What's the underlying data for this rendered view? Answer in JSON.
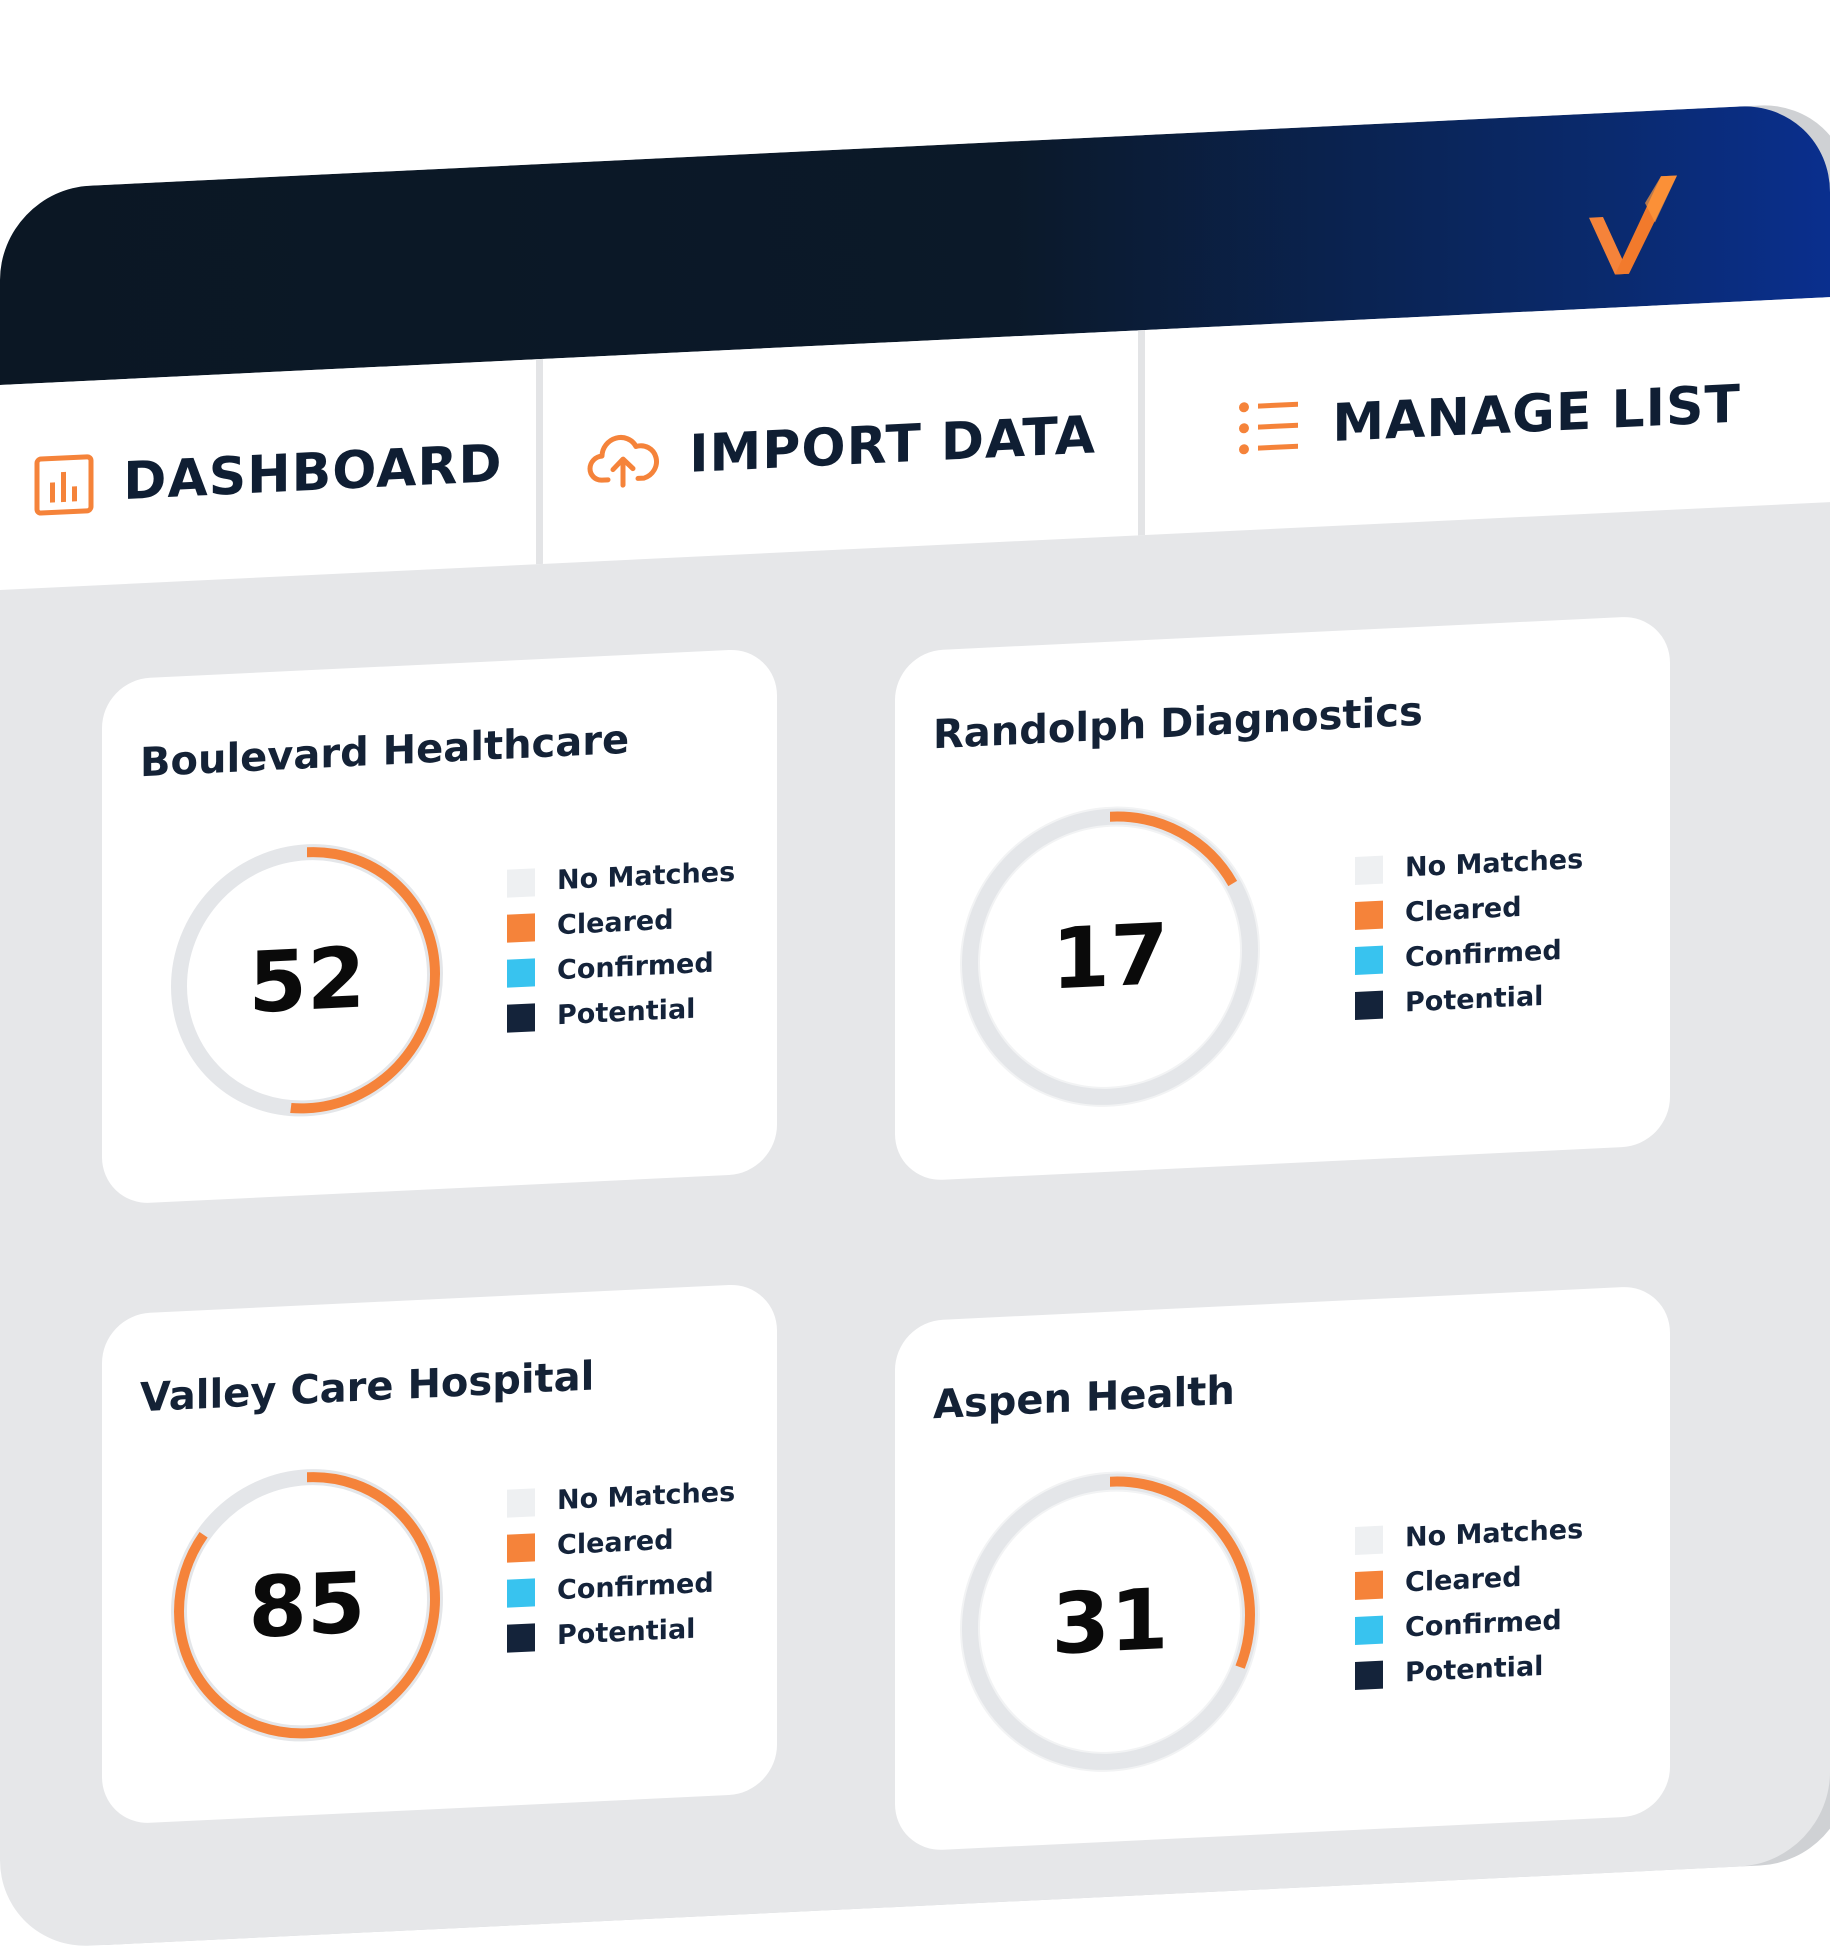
{
  "app": {
    "logo": "checkmark-logo",
    "colors": {
      "accent": "#f5833a",
      "titlebar": "#0b1724",
      "titlebar_end": "#0a2f8e",
      "frame": "#e6e7e9",
      "track": "#e4e6e9"
    }
  },
  "tabs": [
    {
      "label": "DASHBOARD",
      "icon": "bar-chart-icon"
    },
    {
      "label": "IMPORT DATA",
      "icon": "cloud-upload-icon"
    },
    {
      "label": "MANAGE LIST",
      "icon": "list-icon"
    }
  ],
  "legend": [
    {
      "label": "No Matches",
      "color": "#eef0f2"
    },
    {
      "label": "Cleared",
      "color": "#f5833a"
    },
    {
      "label": "Confirmed",
      "color": "#38c3ef"
    },
    {
      "label": "Potential",
      "color": "#14233a"
    }
  ],
  "cards": [
    {
      "title": "Boulevard Healthcare",
      "value": "52",
      "progress": 0.52
    },
    {
      "title": "Randolph Diagnostics",
      "value": "17",
      "progress": 0.17
    },
    {
      "title": "Valley Care Hospital",
      "value": "85",
      "progress": 0.85
    },
    {
      "title": "Aspen Health",
      "value": "31",
      "progress": 0.31
    }
  ]
}
